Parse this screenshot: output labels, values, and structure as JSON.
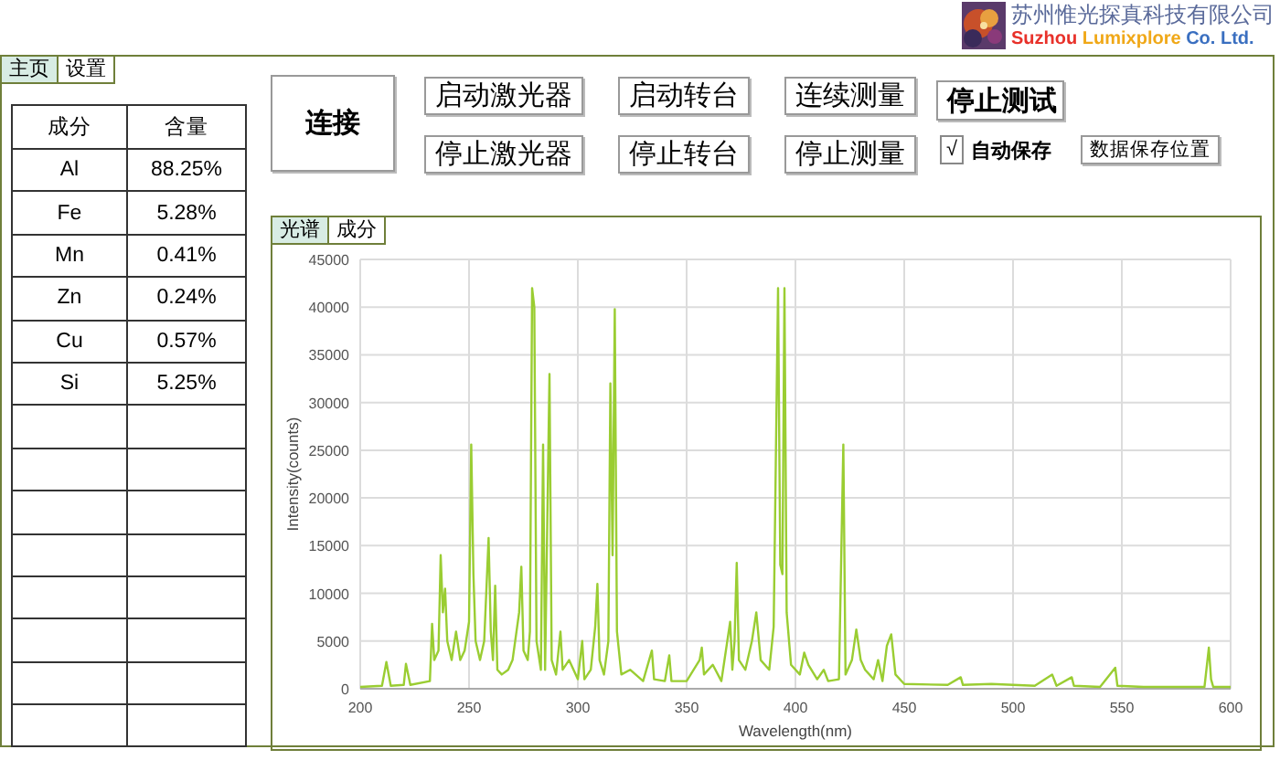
{
  "logo": {
    "company": "苏州惟光探真科技有限公司",
    "english": [
      {
        "text": "Suzhou",
        "color": "#e8312a"
      },
      {
        "text": "Lumixplore",
        "color": "#f0a818"
      },
      {
        "text": "Co. Ltd.",
        "color": "#3a6fc0"
      }
    ]
  },
  "tabs": [
    {
      "label": "主页",
      "selected": true
    },
    {
      "label": "设置",
      "selected": false
    }
  ],
  "table": {
    "columns": [
      "成分",
      "含量"
    ],
    "rows": [
      [
        "Al",
        "88.25%"
      ],
      [
        "Fe",
        "5.28%"
      ],
      [
        "Mn",
        "0.41%"
      ],
      [
        "Zn",
        "0.24%"
      ],
      [
        "Cu",
        "0.57%"
      ],
      [
        "Si",
        "5.25%"
      ]
    ]
  },
  "toolbar": {
    "connect": "连接",
    "columns": [
      {
        "top": "启动激光器",
        "bottom": "停止激光器"
      },
      {
        "top": "启动转台",
        "bottom": "停止转台"
      },
      {
        "top": "连续测量",
        "bottom": "停止测量"
      }
    ],
    "stop_test": "停止测试",
    "auto_save": {
      "mark": "√",
      "label": "自动保存",
      "checked": true
    },
    "save_location": "数据保存位置"
  },
  "chart_tabs": [
    {
      "label": "光谱",
      "selected": true
    },
    {
      "label": "成分",
      "selected": false
    }
  ],
  "chart_data": {
    "type": "line",
    "grid": true,
    "xlabel": "Wavelength(nm)",
    "ylabel": "Intensity(counts)",
    "xlim": [
      200,
      600
    ],
    "ylim": [
      0,
      45000
    ],
    "xticks": [
      200,
      250,
      300,
      350,
      400,
      450,
      500,
      550,
      600
    ],
    "yticks": [
      0,
      5000,
      10000,
      15000,
      20000,
      25000,
      30000,
      35000,
      40000,
      45000
    ],
    "x": [
      200,
      210,
      212,
      214,
      220,
      221,
      223,
      232,
      233,
      234,
      236,
      237,
      238,
      239,
      240,
      242,
      244,
      246,
      248,
      250,
      251,
      252,
      253,
      255,
      257,
      259,
      260,
      261,
      262,
      263,
      265,
      268,
      270,
      273,
      274,
      275,
      277,
      278,
      279,
      280,
      281,
      283,
      284,
      285,
      287,
      288,
      290,
      292,
      293,
      296,
      300,
      302,
      303,
      306,
      308,
      309,
      310,
      312,
      314,
      315,
      316,
      317,
      318,
      320,
      324,
      330,
      334,
      335,
      340,
      342,
      343,
      350,
      356,
      357,
      358,
      362,
      366,
      370,
      371,
      372,
      373,
      374,
      377,
      380,
      382,
      384,
      388,
      390,
      392,
      393,
      394,
      395,
      396,
      398,
      402,
      404,
      406,
      410,
      413,
      415,
      420,
      422,
      423,
      426,
      428,
      430,
      432,
      436,
      438,
      440,
      442,
      444,
      446,
      450,
      470,
      476,
      477,
      490,
      510,
      518,
      520,
      527,
      528,
      540,
      547,
      548,
      560,
      588,
      590,
      591,
      592,
      600
    ],
    "series": [
      {
        "color": "#9acd32",
        "values": [
          200,
          300,
          2800,
          300,
          400,
          2600,
          400,
          800,
          6800,
          3000,
          4000,
          14000,
          8000,
          10500,
          5000,
          3000,
          6000,
          3000,
          4000,
          7000,
          25600,
          12000,
          5000,
          3000,
          5000,
          15800,
          6000,
          3000,
          10800,
          2000,
          1500,
          2000,
          3000,
          8000,
          12800,
          4000,
          3000,
          6000,
          42000,
          40000,
          5000,
          2000,
          25600,
          2000,
          33000,
          3000,
          1500,
          6000,
          2000,
          3000,
          1000,
          5000,
          1000,
          2000,
          6500,
          11000,
          3000,
          1500,
          5000,
          32000,
          14000,
          39800,
          6000,
          1500,
          2000,
          800,
          4000,
          1000,
          800,
          3500,
          800,
          800,
          3000,
          4300,
          1500,
          2500,
          800,
          7000,
          2000,
          5000,
          13200,
          3000,
          2000,
          5000,
          8000,
          3000,
          2000,
          6500,
          42000,
          13000,
          12000,
          42000,
          8000,
          2500,
          1500,
          3800,
          2500,
          1000,
          2000,
          800,
          1000,
          25600,
          1500,
          3000,
          6200,
          3000,
          2000,
          1000,
          3000,
          800,
          4500,
          5700,
          1500,
          500,
          400,
          1200,
          400,
          500,
          300,
          1500,
          300,
          1200,
          300,
          200,
          2200,
          300,
          200,
          200,
          4300,
          1000,
          200,
          200
        ]
      }
    ]
  }
}
